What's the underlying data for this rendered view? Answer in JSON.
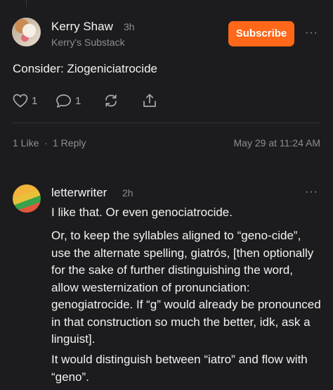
{
  "post": {
    "author": "Kerry Shaw",
    "time": "3h",
    "publication": "Kerry's Substack",
    "subscribe_label": "Subscribe",
    "more": "···",
    "body": "Consider: Ziogeniciatrocide",
    "like_count": "1",
    "comment_count": "1",
    "likes_text": "1 Like",
    "separator": "·",
    "replies_text": "1 Reply",
    "date_text": "May 29 at 11:24 AM"
  },
  "reply": {
    "author": "letterwriter",
    "time": "2h",
    "more": "···",
    "paragraph1": "I like that. Or even genociatrocide.",
    "paragraph2": "Or, to keep the syllables aligned to “geno-cide”, use the alternate spelling, giatrós, [then optionally for the sake of further distinguishing the word, allow westernization of pronunciation: genogiatrocide. If “g” would already be pronounced in that construction so much the better, idk, ask a linguist].",
    "paragraph3": "It would distinguish between “iatro” and flow with “geno”."
  },
  "icons": {
    "like": "heart-icon",
    "comment": "comment-bubble-icon",
    "restack": "restack-icon",
    "share": "share-icon"
  },
  "colors": {
    "background": "#1c1c1e",
    "accent": "#ff6719",
    "muted": "#8e8e93"
  }
}
